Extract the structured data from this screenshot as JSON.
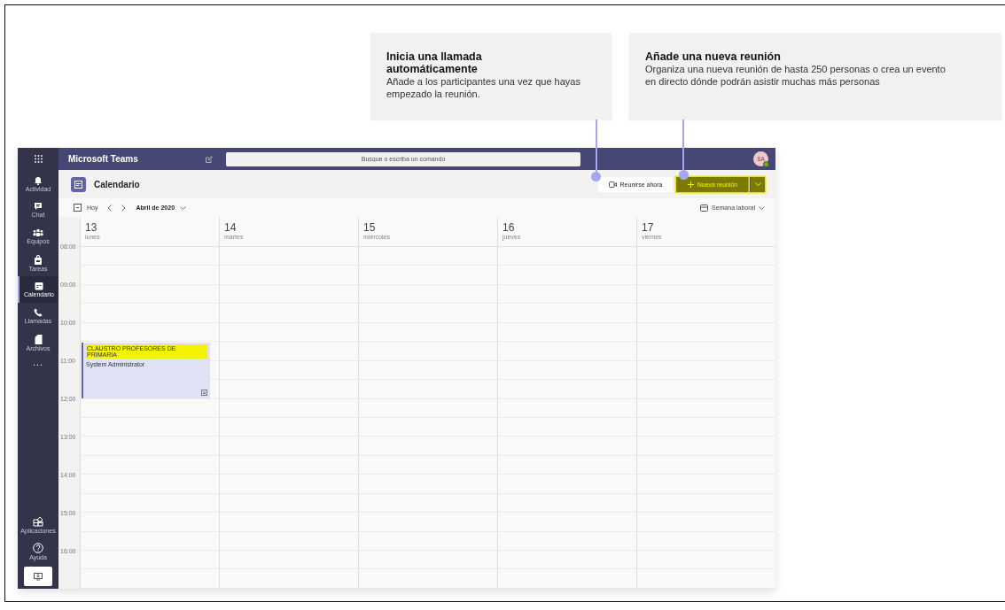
{
  "callouts": [
    {
      "title": "Inicia una llamada automáticamente",
      "text": "Añade a los participantes una vez que hayas empezado la reunión."
    },
    {
      "title": "Añade una nueva reunión",
      "text": "Organiza una nueva reunión de hasta 250 personas o crea un evento en directo dónde podrán asistir muchas más personas"
    }
  ],
  "app": {
    "title": "Microsoft Teams",
    "search": {
      "placeholder": "Busque o escriba un comando"
    },
    "avatar": {
      "initials": "SA",
      "online": true
    }
  },
  "rail": {
    "items": [
      {
        "kind": "bell",
        "label": "Actividad",
        "selected": false
      },
      {
        "kind": "chat",
        "label": "Chat",
        "selected": false
      },
      {
        "kind": "team",
        "label": "Equipos",
        "selected": false
      },
      {
        "kind": "bag",
        "label": "Tareas",
        "selected": false
      },
      {
        "kind": "calendar",
        "label": "Calendario",
        "selected": true
      },
      {
        "kind": "phone",
        "label": "Llamadas",
        "selected": false
      },
      {
        "kind": "file",
        "label": "Archivos",
        "selected": false
      }
    ],
    "more": "...",
    "bottom": [
      {
        "kind": "apps",
        "label": "Aplicaciones"
      },
      {
        "kind": "help",
        "label": "Ayuda"
      }
    ]
  },
  "header": {
    "title": "Calendario",
    "meet_now": "Reunirse ahora",
    "new_meeting": {
      "label": "Nueva reunión",
      "highlighted": true
    }
  },
  "toolbar": {
    "today": "Hoy",
    "month": "Abril de 2020",
    "view": "Semana laboral"
  },
  "days": [
    {
      "number": "13",
      "name": "lunes",
      "events": [
        {
          "title": "CLAUSTRO PROFESORES DE PRIMARIA",
          "organizer": "System Administrator",
          "highlighted": true
        }
      ]
    },
    {
      "number": "14",
      "name": "martes"
    },
    {
      "number": "15",
      "name": "miércoles"
    },
    {
      "number": "16",
      "name": "jueves"
    },
    {
      "number": "17",
      "name": "viernes"
    }
  ],
  "times": [
    "08:00",
    "09:00",
    "10:00",
    "11:00",
    "12:00",
    "13:00",
    "14:00",
    "15:00",
    "16:00"
  ]
}
